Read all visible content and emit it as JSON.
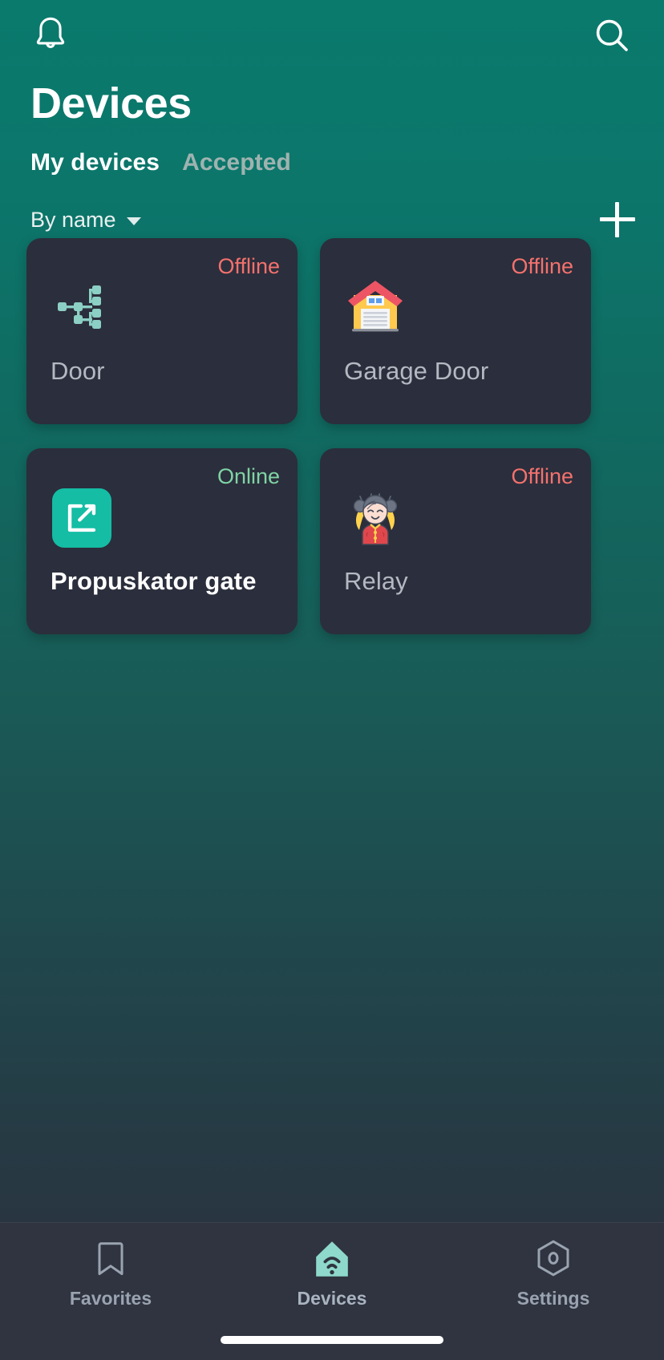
{
  "header": {
    "notification_icon": "bell-icon",
    "search_icon": "search-icon",
    "title": "Devices"
  },
  "tabs": [
    {
      "label": "My devices",
      "active": true
    },
    {
      "label": "Accepted",
      "active": false
    }
  ],
  "toolbar": {
    "sort_label": "By name",
    "sort_caret_icon": "chevron-down-icon",
    "add_label": "+",
    "add_icon": "plus-icon"
  },
  "devices": [
    {
      "name": "Door",
      "status": "Offline",
      "status_state": "offline",
      "icon": "network-tree-icon",
      "icon_color": "#8ccfc4"
    },
    {
      "name": "Garage Door",
      "status": "Offline",
      "status_state": "offline",
      "icon": "garage-emoji-icon",
      "icon_color": "#ffc94d"
    },
    {
      "name": "Propuskator gate",
      "status": "Online",
      "status_state": "online",
      "icon": "exit-arrow-icon",
      "icon_color": "#14bda4"
    },
    {
      "name": "Relay",
      "status": "Offline",
      "status_state": "offline",
      "icon": "girl-emoji-icon",
      "icon_color": "#e0474c"
    }
  ],
  "bottom_nav": [
    {
      "label": "Favorites",
      "icon": "bookmark-icon",
      "active": false
    },
    {
      "label": "Devices",
      "icon": "home-wifi-icon",
      "active": true
    },
    {
      "label": "Settings",
      "icon": "hexagon-gear-icon",
      "active": false
    }
  ],
  "colors": {
    "background_top": "#0a7a6d",
    "background_bottom": "#2e3340",
    "card": "#2b2e3c",
    "accent": "#14bda4",
    "offline": "#f4716d",
    "online": "#7fd4a4",
    "nav_bar": "#2f3440"
  }
}
